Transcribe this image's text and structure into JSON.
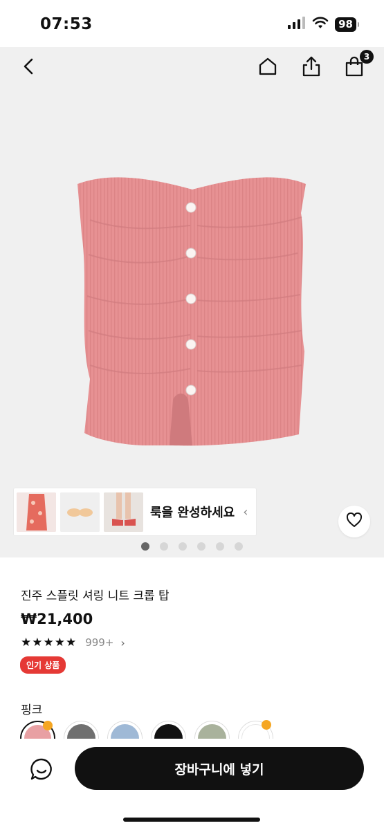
{
  "status": {
    "time": "07:53",
    "battery": "98"
  },
  "nav": {
    "cart_count": "3"
  },
  "outfit": {
    "text": "룩을 완성하세요"
  },
  "carousel": {
    "count": 6,
    "active": 0
  },
  "product": {
    "title": "진주 스플릿 셔링 니트 크롭 탑",
    "price": "₩21,400",
    "rating_stars": 5,
    "review_count": "999+",
    "badge": "인기 상품",
    "color_label": "핑크"
  },
  "swatches": [
    {
      "color": "#e8a0a3",
      "selected": true,
      "hot": true
    },
    {
      "color": "#6f6f6f",
      "selected": false,
      "hot": false
    },
    {
      "color": "#9fb9d6",
      "selected": false,
      "hot": false
    },
    {
      "color": "#111111",
      "selected": false,
      "hot": false
    },
    {
      "color": "#a9b29c",
      "selected": false,
      "hot": false
    },
    {
      "color": "#ffffff",
      "selected": false,
      "hot": true
    }
  ],
  "actions": {
    "add_to_cart": "장바구니에 넣기"
  },
  "colors": {
    "product_pink": "#e79193",
    "badge_red": "#e53935"
  }
}
